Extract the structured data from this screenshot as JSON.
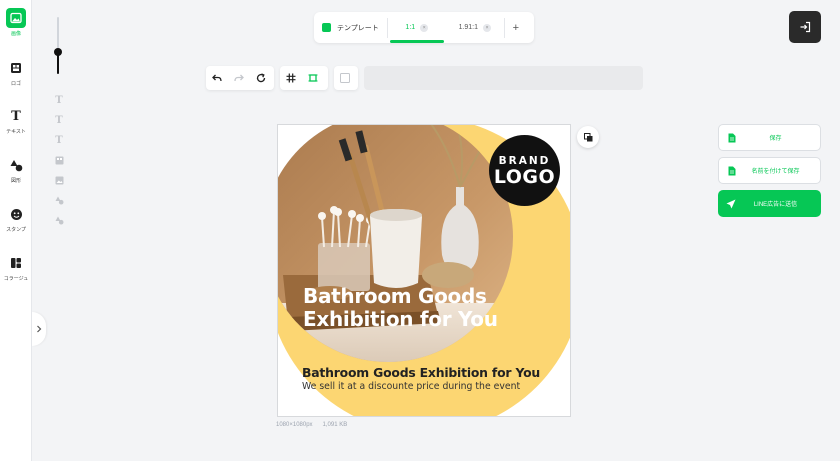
{
  "rail": {
    "items": [
      {
        "label": "画像",
        "icon": "image-icon",
        "active": true
      },
      {
        "label": "ロゴ",
        "icon": "logo-grid-icon"
      },
      {
        "label": "テキスト",
        "icon": "text-icon"
      },
      {
        "label": "図形",
        "icon": "shapes-icon"
      },
      {
        "label": "スタンプ",
        "icon": "stamp-icon"
      },
      {
        "label": "コラージュ",
        "icon": "collage-icon"
      }
    ]
  },
  "subtools": [
    "T",
    "T",
    "T"
  ],
  "template_bar": {
    "template_label": "テンプレート",
    "ratios": [
      {
        "label": "1:1",
        "active": true
      },
      {
        "label": "1.91:1",
        "active": false
      }
    ],
    "add_label": "+"
  },
  "canvas": {
    "logo_line1": "BRAND",
    "logo_line2": "LOGO",
    "headline_line1": "Bathroom Goods",
    "headline_line2": "Exhibition for You",
    "subhead": "Bathroom Goods Exhibition for You",
    "tagline": "We sell it at a discounte price during the event",
    "size_text": "1080×1080px",
    "file_size": "1,091 KB"
  },
  "actions": {
    "save": "保存",
    "save_as": "名前を付けて保存",
    "send_line": "LINE広告に送信"
  },
  "colors": {
    "accent": "#06c755",
    "canvas_yellow": "#fcd672",
    "dark": "#2a2a2a"
  }
}
